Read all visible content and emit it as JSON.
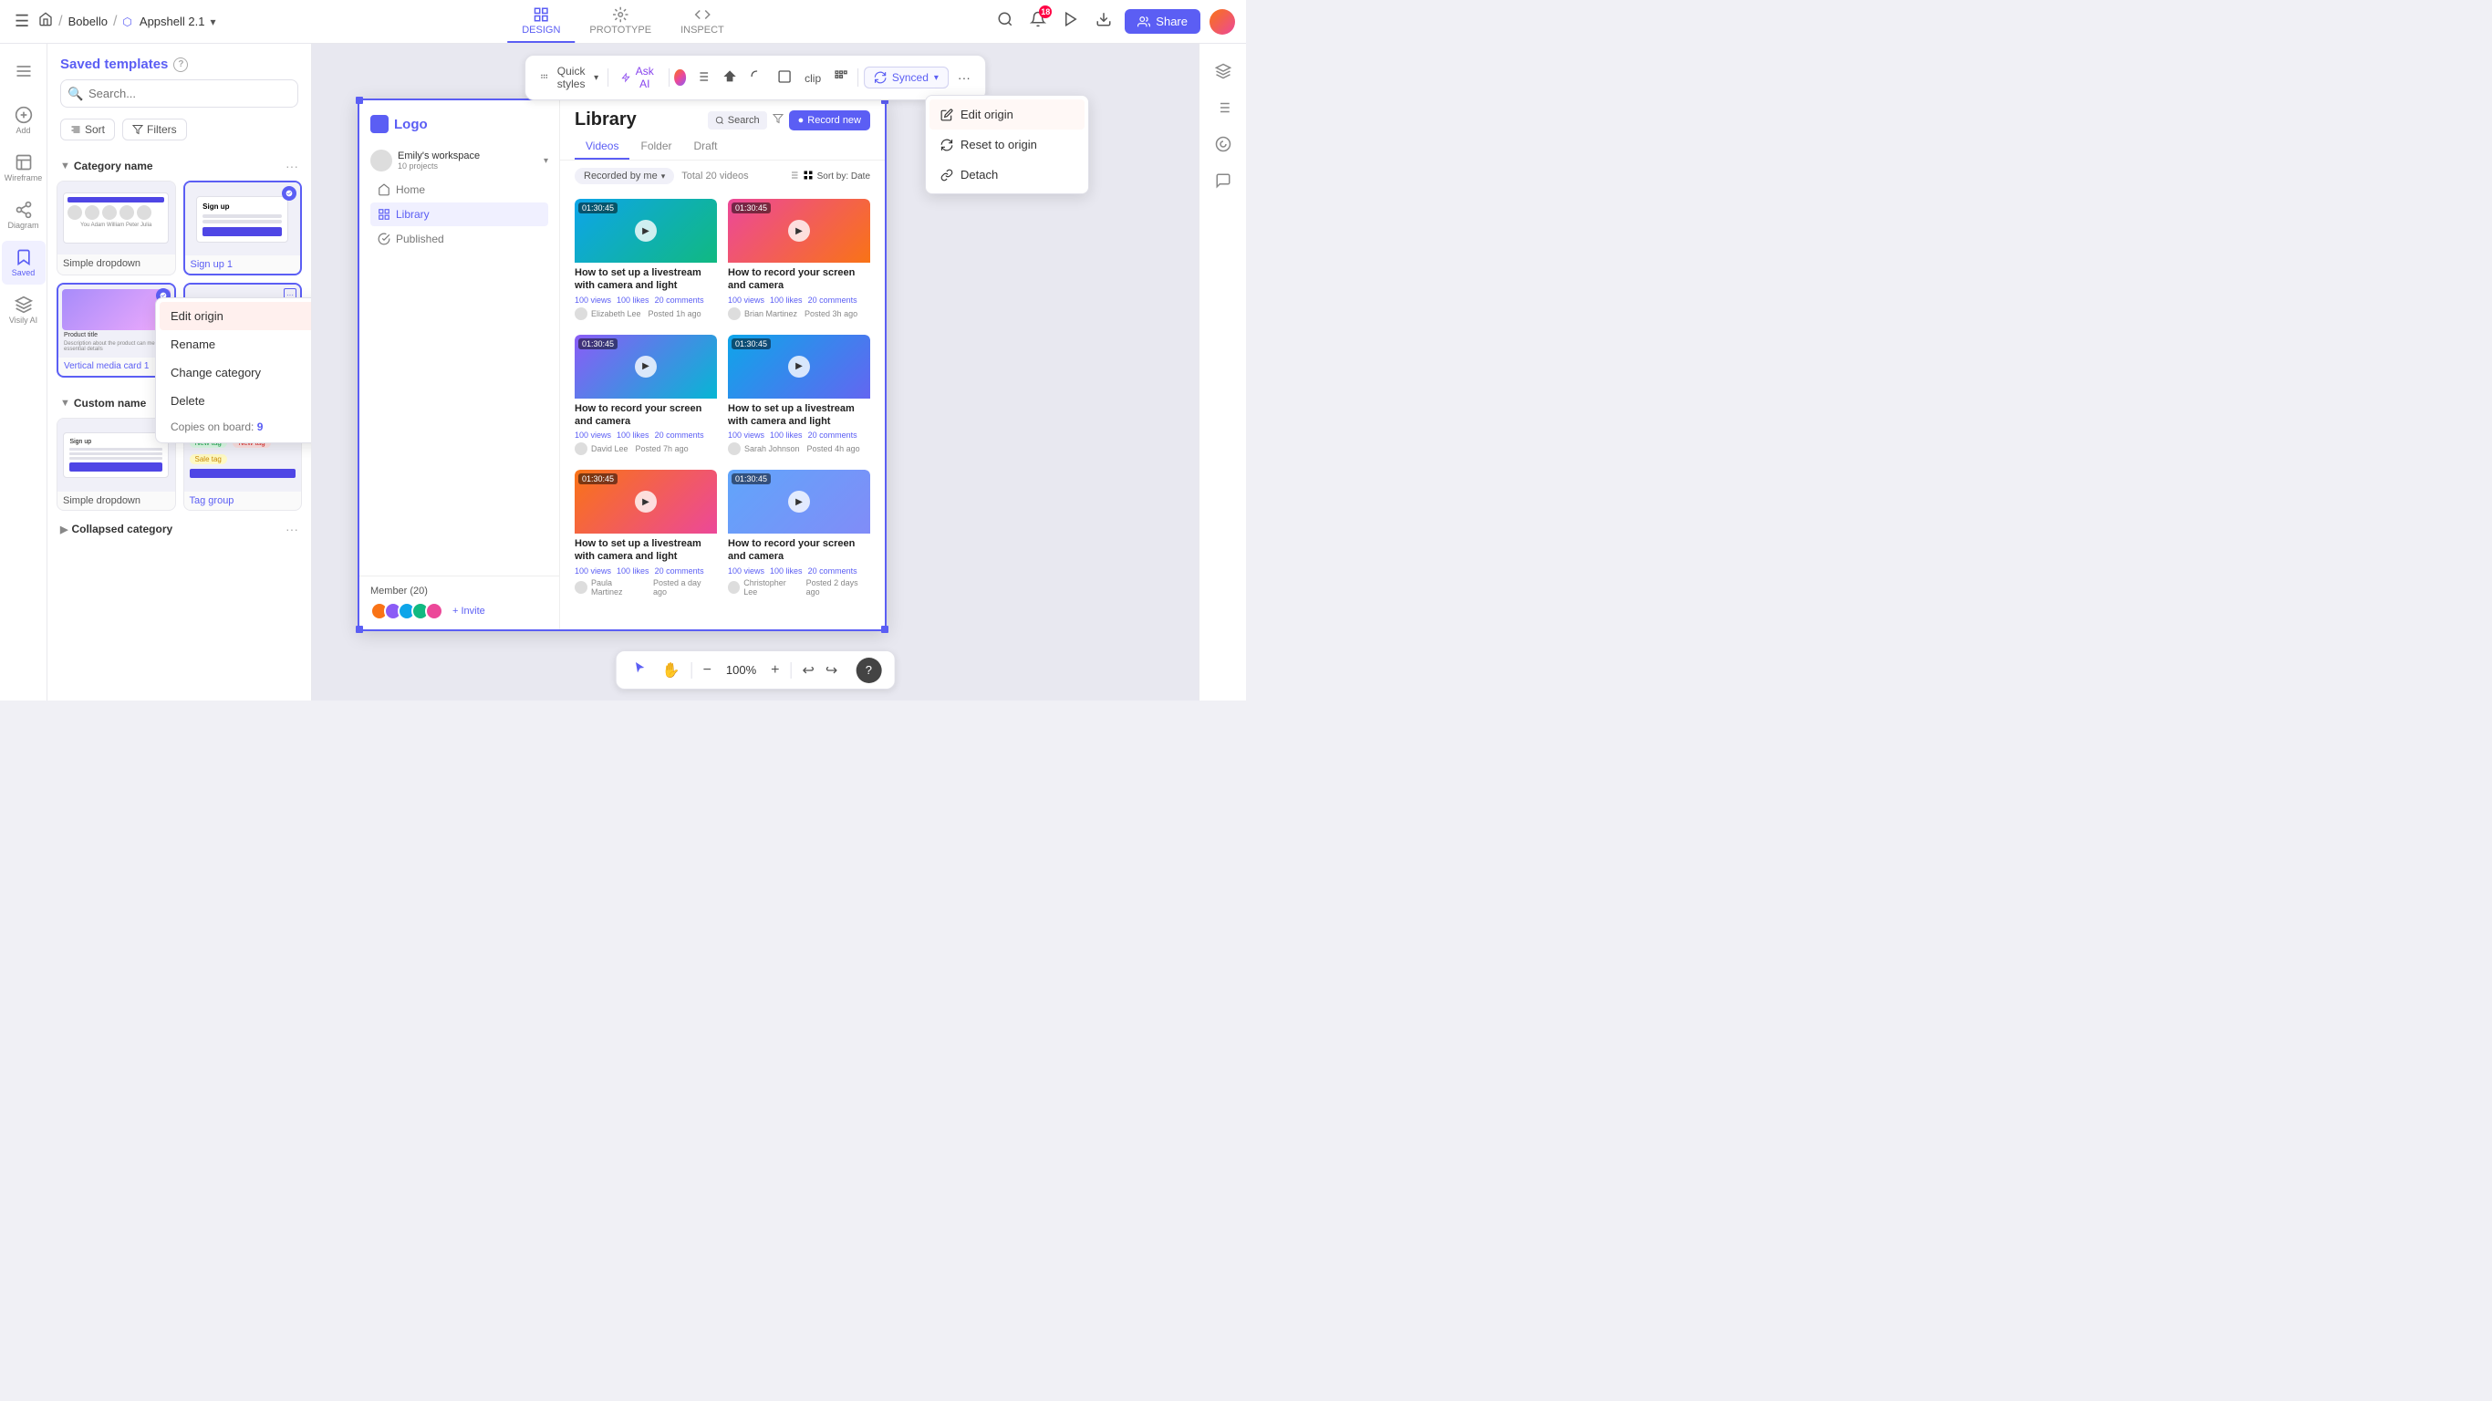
{
  "topnav": {
    "home_icon": "home",
    "breadcrumb_separator": "/",
    "workspace": "Bobello",
    "separator": "/",
    "app_icon": "appshell",
    "app_name": "Appshell 2.1",
    "chevron": "▾",
    "tabs": [
      {
        "id": "design",
        "label": "DESIGN",
        "active": true
      },
      {
        "id": "prototype",
        "label": "PROTOTYPE",
        "active": false
      },
      {
        "id": "inspect",
        "label": "INSPECT",
        "active": false
      }
    ],
    "search_icon": "search",
    "notification_count": "18",
    "play_icon": "play",
    "download_icon": "download",
    "share_label": "Share"
  },
  "left_thin_sidebar": {
    "items": [
      {
        "id": "menu",
        "label": "",
        "icon": "menu"
      },
      {
        "id": "add",
        "label": "Add",
        "icon": "plus"
      },
      {
        "id": "wireframe",
        "label": "Wireframe",
        "icon": "wireframe"
      },
      {
        "id": "diagram",
        "label": "Diagram",
        "icon": "diagram"
      },
      {
        "id": "saved",
        "label": "Saved",
        "active": true,
        "icon": "bookmark"
      },
      {
        "id": "visily",
        "label": "Visily AI",
        "icon": "ai"
      }
    ]
  },
  "left_panel": {
    "title": "Saved templates",
    "help_icon": "question",
    "search_placeholder": "Search...",
    "sort_label": "Sort",
    "filters_label": "Filters",
    "categories": [
      {
        "name": "Category name",
        "collapsed": false,
        "more_icon": "dots",
        "templates": [
          {
            "id": "simple-dropdown",
            "label": "Simple dropdown",
            "label_color": "gray",
            "thumb_type": "signup"
          },
          {
            "id": "sign-up-1",
            "label": "Sign up 1",
            "label_color": "blue",
            "thumb_type": "signup2",
            "synced": true
          }
        ]
      },
      {
        "name": "Custom name",
        "collapsed": false,
        "more_icon": "dots",
        "templates": [
          {
            "id": "simple-dropdown-2",
            "label": "Simple dropdown",
            "label_color": "gray",
            "thumb_type": "tags"
          },
          {
            "id": "tag-group",
            "label": "Tag group",
            "label_color": "blue",
            "thumb_type": "media_card",
            "synced": true
          }
        ]
      },
      {
        "name": "Collapsed category",
        "collapsed": true,
        "more_icon": "dots",
        "templates": []
      }
    ]
  },
  "toolbar": {
    "quick_styles_label": "Quick styles",
    "quick_styles_icon": "grip",
    "ask_ai_label": "Ask AI",
    "tools": [
      "list",
      "shape-fill",
      "corner-round",
      "rectangle",
      "clip",
      "pattern"
    ],
    "synced_label": "Synced",
    "synced_icon": "sync",
    "more_icon": "dots"
  },
  "synced_dropdown": {
    "items": [
      {
        "id": "edit-origin",
        "label": "Edit origin",
        "icon": "edit",
        "highlighted": true
      },
      {
        "id": "reset-to-origin",
        "label": "Reset to origin",
        "icon": "reset"
      },
      {
        "id": "detach",
        "label": "Detach",
        "icon": "detach"
      }
    ]
  },
  "context_menu": {
    "items": [
      {
        "id": "edit-origin",
        "label": "Edit origin",
        "active": true,
        "has_arrow": false
      },
      {
        "id": "rename",
        "label": "Rename",
        "has_arrow": true
      },
      {
        "id": "change-category",
        "label": "Change category",
        "has_arrow": true
      },
      {
        "id": "delete",
        "label": "Delete",
        "has_arrow": false
      }
    ],
    "footer": "Copies on board:",
    "copies_count": "9"
  },
  "canvas_app": {
    "logo_text": "Logo",
    "workspace_name": "Emily's workspace",
    "workspace_projects": "10 projects",
    "nav_items": [
      {
        "id": "home",
        "label": "Home",
        "active": false
      },
      {
        "id": "library",
        "label": "Library",
        "active": true
      },
      {
        "id": "published",
        "label": "Published",
        "active": false
      }
    ],
    "header_title": "Library",
    "tabs": [
      {
        "id": "videos",
        "label": "Videos",
        "active": true
      },
      {
        "id": "folder",
        "label": "Folder"
      },
      {
        "id": "draft",
        "label": "Draft"
      }
    ],
    "filter_label": "Recorded by me",
    "total_label": "Total 20 videos",
    "sort_label": "Sort by: Date",
    "search_placeholder": "Search",
    "record_new_label": "Record new",
    "videos": [
      {
        "id": "v1",
        "duration": "01:30:45",
        "title": "How to set up a livestream with camera and light",
        "views": "100 views",
        "likes": "100 likes",
        "comments": "20 comments",
        "author": "Elizabeth Lee",
        "posted": "Posted 1h ago",
        "thumb_class": "grad1"
      },
      {
        "id": "v2",
        "duration": "01:30:45",
        "title": "How to record your screen and camera",
        "views": "100 views",
        "likes": "100 likes",
        "comments": "20 comments",
        "author": "Brian Martinez",
        "posted": "Posted 3h ago",
        "thumb_class": "grad2"
      },
      {
        "id": "v3",
        "duration": "01:30:45",
        "title": "How to record your screen and camera",
        "views": "100 views",
        "likes": "100 likes",
        "comments": "20 comments",
        "author": "David Lee",
        "posted": "Posted 7h ago",
        "thumb_class": "grad3"
      },
      {
        "id": "v4",
        "duration": "01:30:45",
        "title": "How to set up a livestream with camera and light",
        "views": "100 views",
        "likes": "100 likes",
        "comments": "20 comments",
        "author": "Sarah Johnson",
        "posted": "Posted 4h ago",
        "thumb_class": "grad4"
      },
      {
        "id": "v5",
        "duration": "01:30:45",
        "title": "How to set up a livestream with camera and light",
        "views": "100 views",
        "likes": "100 likes",
        "comments": "20 comments",
        "author": "Paula Martinez",
        "posted": "Posted a day ago",
        "thumb_class": "grad5"
      },
      {
        "id": "v6",
        "duration": "01:30:45",
        "title": "How to record your screen and camera",
        "views": "100 views",
        "likes": "100 likes",
        "comments": "20 comments",
        "author": "Christopher Lee",
        "posted": "Posted 2 days ago",
        "thumb_class": "grad6"
      }
    ],
    "member_title": "Member (20)",
    "invite_label": "+ Invite"
  },
  "bottom_toolbar": {
    "cursor_icon": "cursor",
    "hand_icon": "hand",
    "zoom_minus": "−",
    "zoom_level": "100%",
    "zoom_plus": "+",
    "undo_icon": "undo",
    "redo_icon": "redo",
    "help_label": "?"
  },
  "right_panel": {
    "icons": [
      "layers",
      "assets",
      "palette",
      "chat"
    ]
  },
  "colors": {
    "accent": "#5b5ef4",
    "accent_light": "#f0f0ff",
    "danger": "#ef4444",
    "surface": "#ffffff",
    "border": "#e0e0e8"
  }
}
